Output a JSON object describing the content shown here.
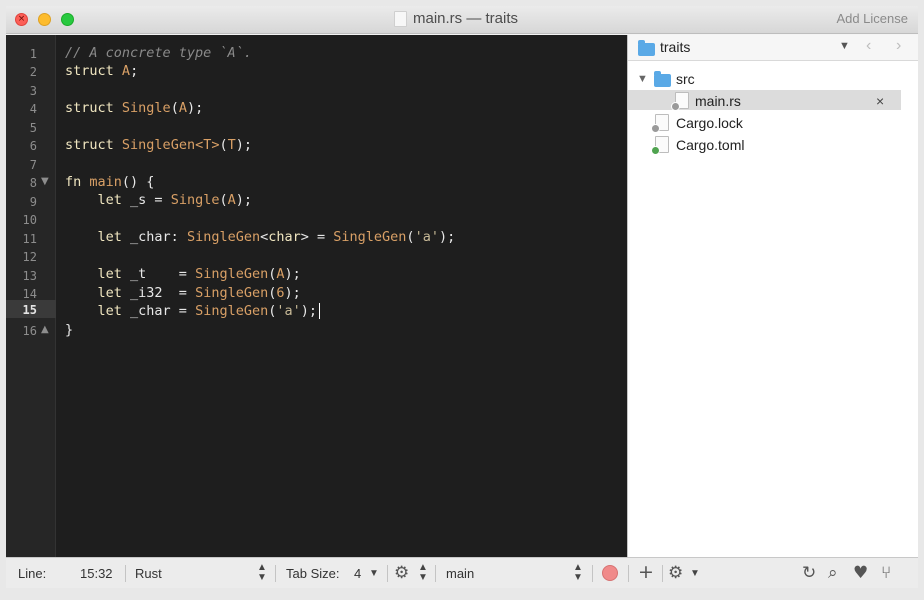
{
  "window": {
    "title": "main.rs — traits",
    "add_license": "Add License",
    "traffic_close": "×",
    "traffic_min": "–",
    "traffic_zoom": "↗"
  },
  "editor": {
    "line_numbers": [
      "1",
      "2",
      "3",
      "4",
      "5",
      "6",
      "7",
      "8",
      "9",
      "10",
      "11",
      "12",
      "13",
      "14",
      "15",
      "16"
    ],
    "active_line": "15"
  },
  "sidebar": {
    "project": "traits",
    "items": [
      {
        "label": "src"
      },
      {
        "label": "main.rs"
      },
      {
        "label": "Cargo.lock"
      },
      {
        "label": "Cargo.toml"
      }
    ],
    "close_label": "×"
  },
  "statusbar": {
    "line_label": "Line:",
    "line_value": "15:32",
    "language": "Rust",
    "tab_size_label": "Tab Size:",
    "tab_size_value": "4",
    "symbol": "main"
  },
  "colors": {
    "editor_bg": "#1e1e1e",
    "keyword": "#f0e6c0",
    "type": "#d9a066",
    "comment": "#8a8a8a",
    "folder": "#5aa9e6",
    "record": "#f08a8a"
  },
  "icons": [
    "folder-icon",
    "file-icon",
    "gear-icon",
    "reload-icon",
    "search-icon",
    "heart-icon",
    "branch-icon",
    "add-icon",
    "record-icon"
  ]
}
